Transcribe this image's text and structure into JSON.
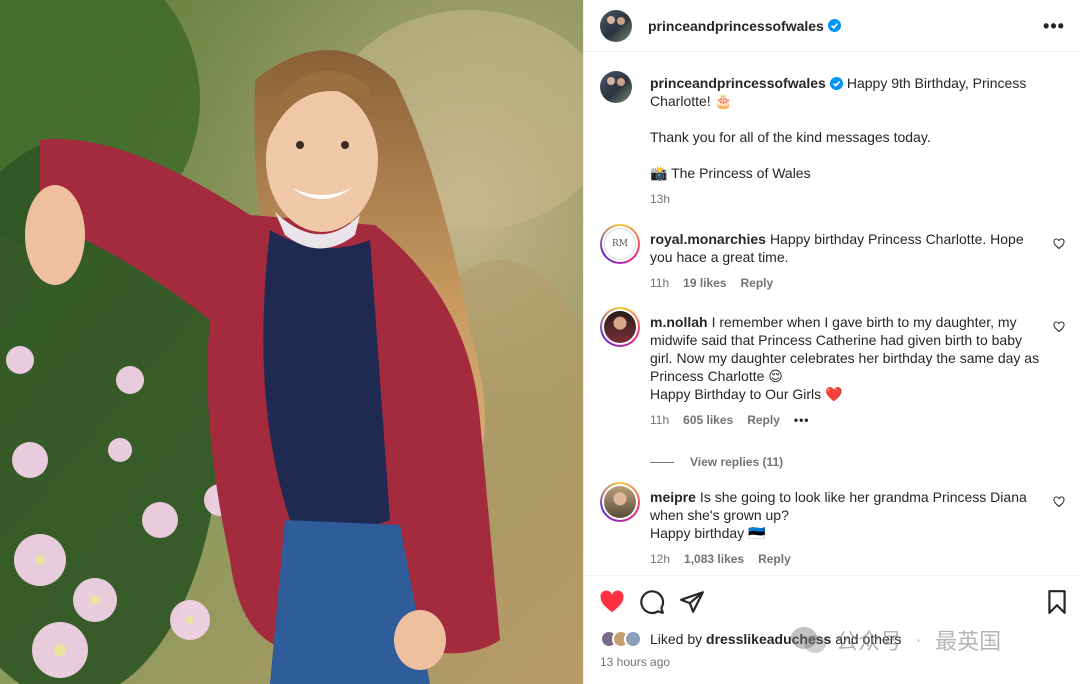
{
  "post": {
    "username": "princeandprincessofwales",
    "more_icon": "more-horizontal-icon",
    "verified_icon": "verified-badge-icon",
    "caption": {
      "username": "princeandprincessofwales",
      "line1": "Happy 9th Birthday, Princess Charlotte! 🎂",
      "line2": "Thank you for all of the kind messages today.",
      "line3": "📸 The Princess of Wales",
      "time": "13h"
    }
  },
  "comments": [
    {
      "username": "royal.monarchies",
      "text": "Happy birthday Princess Charlotte. Hope you hace a great time.",
      "time": "11h",
      "likes": "19 likes",
      "reply": "Reply"
    },
    {
      "username": "m.nollah",
      "text": "I remember when I gave birth to my daughter, my midwife said that Princess Catherine had given birth to baby girl. Now my daughter celebrates her birthday the same day as Princess Charlotte 😌",
      "text2": "Happy Birthday to Our Girls ❤️",
      "time": "11h",
      "likes": "605 likes",
      "reply": "Reply",
      "more": "•••",
      "view_replies": "View replies (11)"
    },
    {
      "username": "meipre",
      "text": "Is she going to look like her grandma Princess Diana when she's grown up?",
      "text2": "Happy birthday 🇪🇪",
      "time": "12h",
      "likes": "1,083 likes",
      "reply": "Reply"
    }
  ],
  "actions": {
    "like_icon": "heart-filled-icon",
    "comment_icon": "comment-icon",
    "share_icon": "share-icon",
    "save_icon": "bookmark-icon",
    "liked_by_prefix": "Liked by ",
    "liked_by_user": "dresslikeaduchess",
    "liked_by_suffix": " and others",
    "time_ago": "13 hours ago"
  },
  "watermark": {
    "text1": "公众号",
    "separator": "·",
    "text2": "最英国"
  },
  "colors": {
    "like_red": "#ff3040",
    "verified_blue": "#0095f6",
    "secondary_text": "#737373"
  }
}
